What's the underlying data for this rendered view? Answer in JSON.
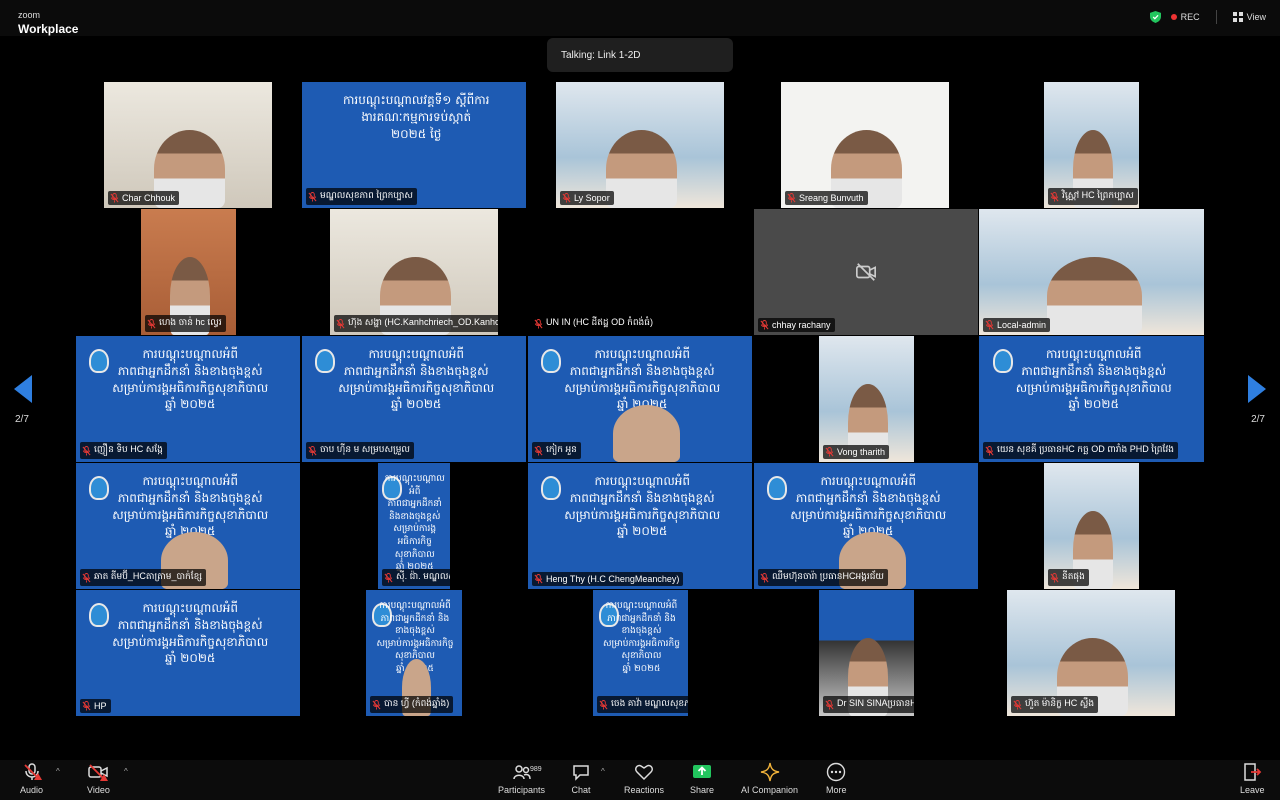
{
  "app": {
    "brand_top": "zoom",
    "brand_main": "Workplace"
  },
  "top_right": {
    "rec_label": "REC",
    "view_label": "View"
  },
  "talking": "Talking: Link 1-2D",
  "pager": {
    "left": "2/7",
    "right": "2/7"
  },
  "participants": [
    {
      "name": "Char Chhouk"
    },
    {
      "name": "មណ្ឌលសុខភាព ព្រៃកប្បាស"
    },
    {
      "name": "Ly Sopor"
    },
    {
      "name": "Sreang Bunvuth"
    },
    {
      "name": "វិស្ណៅ HC ព្រៃកប្បាស"
    },
    {
      "name": "ហេង ចាន់ hc ល្វេរ"
    },
    {
      "name": "ហ៊ុង សង្ហា (HC.Kanhchriech_OD.Kanhchriech_PHD...."
    },
    {
      "name": "UN IN (HC ដីឥដ្ឋ OD កំពង់ធំ)"
    },
    {
      "name": "chhay rachany"
    },
    {
      "name": "Local-admin"
    },
    {
      "name": "ញឿន ទិប HC សង្កែ"
    },
    {
      "name": "ចាប ហ៊ីន ម សម្របសម្រួល"
    },
    {
      "name": "កៀក អួន"
    },
    {
      "name": "Vong tharith"
    },
    {
      "name": "យេន សុខគី ប្រធានHC កច្ឆ OD ពារាំង PHD ព្រៃវែង"
    },
    {
      "name": "ឆាត តីមប៊ី_HCតាត្រាម_បាក់ខ្សែ"
    },
    {
      "name": "ស៊ី. ជ៉ា. មណ្ឌលសុខភាពត្រៀក"
    },
    {
      "name": "Heng Thy (H.C ChengMeanchey)"
    },
    {
      "name": "ឈឹមហ៊ុនចារ៉ា ប្រធានHCអង្គរជ័យ"
    },
    {
      "name": "នីតផុង"
    },
    {
      "name": "HP"
    },
    {
      "name": "បាន ហ្វី (កំពង់ឆ្នាំង)"
    },
    {
      "name": "ចេង គាវ៉ា មណ្ឌលសុខភាពអង្គរ១"
    },
    {
      "name": "Dr SIN SINAប្រធានHC សំរោង OD ព្រៃកប្បាស"
    },
    {
      "name": "ហ៊ួត ម៉ានិក្ខ HC ស្លឹង"
    }
  ],
  "slide": {
    "text_a": "ការបណ្តុះបណ្តាលអំពី\nភាពជាអ្នកដឹកនាំ និងខាងចុងខ្ពស់\nសម្រាប់ការង្គអធិការកិច្ចសុខាភិបាល\nឆ្នាំ ២០២៥",
    "text_b": "ការបណ្តុះបណ្តាលវគ្គទី១ ស្តីពីការ\nងារគណៈកម្មការទប់ស្កាត់\n២០២៥ ថ្ងៃ"
  },
  "toolbar": {
    "audio": "Audio",
    "video": "Video",
    "participants": "Participants",
    "participants_count": "989",
    "chat": "Chat",
    "reactions": "Reactions",
    "share": "Share",
    "ai": "AI Companion",
    "more": "More",
    "leave": "Leave"
  },
  "colors": {
    "accent": "#2f7fe0",
    "slide_blue": "#1e5bb3",
    "share_green": "#22c55e",
    "muted_red": "#e53935"
  }
}
